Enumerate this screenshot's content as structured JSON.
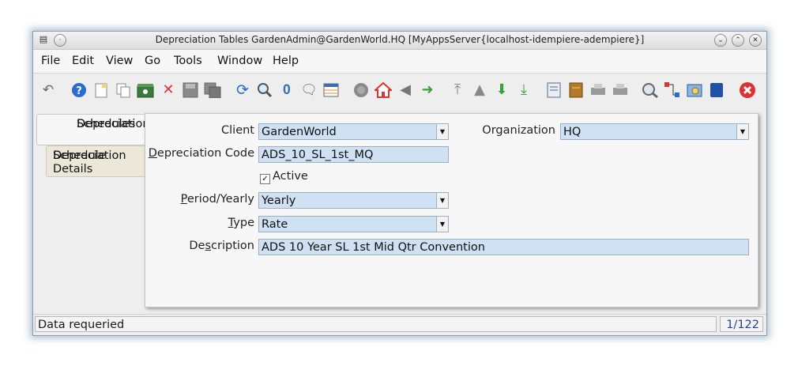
{
  "window": {
    "title": "Depreciation Tables  GardenAdmin@GardenWorld.HQ [MyAppsServer{localhost-idempiere-adempiere}]"
  },
  "menubar": {
    "file": "File",
    "edit": "Edit",
    "view": "View",
    "go": "Go",
    "tools": "Tools",
    "window": "Window",
    "help": "Help"
  },
  "tabs": [
    {
      "line1": "Depreciation",
      "line2": "Schedules"
    },
    {
      "line1": "Depreciation",
      "line2": "Schedule Details"
    }
  ],
  "form": {
    "client": {
      "label": "Client",
      "value": "GardenWorld"
    },
    "organization": {
      "label": "Organization",
      "value": "HQ"
    },
    "depreciation_code": {
      "label": "Depreciation Code",
      "value": "ADS_10_SL_1st_MQ"
    },
    "active": {
      "label": "Active",
      "checked": true
    },
    "period_yearly": {
      "label": "Period/Yearly",
      "value": "Yearly"
    },
    "type": {
      "label": "Type",
      "value": "Rate"
    },
    "description": {
      "label": "Description",
      "value": "ADS 10 Year SL 1st Mid Qtr Convention"
    }
  },
  "status": {
    "message": "Data requeried",
    "record_count": "1/122"
  },
  "colors": {
    "field_bg": "#cfe1f3",
    "inactive_tab": "#ebe8d9",
    "delete_red": "#e03030",
    "confirm_green": "#3aa03a",
    "help_blue": "#2a6bd1"
  }
}
